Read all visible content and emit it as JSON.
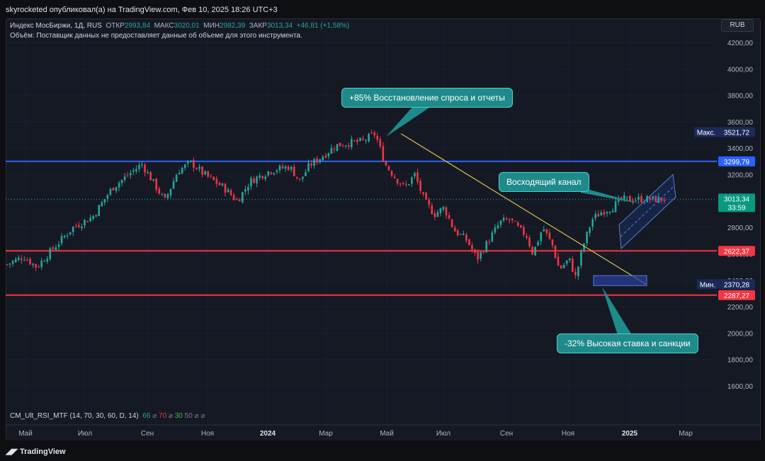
{
  "header": {
    "published": "skyrocketed опубликовал(а) на TradingView.com, Фев 10, 2025 18:26 UTC+3"
  },
  "legend": {
    "symbol": "Индекс МосБиржи, 1Д, RUS",
    "open_label": "ОТКР",
    "open": "2993,84",
    "high_label": "МАКС",
    "high": "3020,01",
    "low_label": "МИН",
    "low": "2982,39",
    "close_label": "ЗАКР",
    "close": "3013,34",
    "change": "+46,81 (+1,58%)",
    "volume_note": "Объём: Поставщик данных не предоставляет данные об объеме для этого инструмента."
  },
  "currency": "RUB",
  "indicator": {
    "name": "CM_Ult_RSI_MTF (14, 70, 30, 60, D, 14)",
    "v1": "66",
    "v2": "70",
    "v3": "30",
    "v4": "50",
    "c1": "#26a69a",
    "c2": "#f23645",
    "c3": "#4caf50",
    "c4": "#787b86"
  },
  "callouts": {
    "top": "+85% Восстановление спроса и отчеты",
    "channel": "Восходящий канал",
    "bottom": "-32% Высокая ставка и санкции"
  },
  "brand": "TradingView",
  "chart_data": {
    "type": "candlestick",
    "y_ticks": [
      "4200,00",
      "4000,00",
      "3800,00",
      "3600,00",
      "3400,00",
      "3200,00",
      "3000,00",
      "2800,00",
      "2600,00",
      "2400,00",
      "2200,00",
      "2000,00",
      "1800,00",
      "1600,00"
    ],
    "y_tick_values": [
      4200,
      4000,
      3800,
      3600,
      3400,
      3200,
      3000,
      2800,
      2600,
      2400,
      2200,
      2000,
      1800,
      1600
    ],
    "x_ticks": [
      "Май",
      "Июл",
      "Сен",
      "Ноя",
      "2024",
      "Мар",
      "Май",
      "Июл",
      "Сен",
      "Ноя",
      "2025",
      "Мар"
    ],
    "ylim": [
      1480,
      4260
    ],
    "price_labels": {
      "max_label": "Макс.",
      "max": "3521,72",
      "blue_level": "3299,79",
      "last": "3013,34",
      "timer": "33:59",
      "red_level_1": "2622,37",
      "min_label": "Мин.",
      "min": "2370,28",
      "red_level_2": "2287,27"
    },
    "levels": {
      "blue": {
        "value": 3299.79,
        "color": "#2962ff"
      },
      "red1": {
        "value": 2622.37,
        "color": "#f23645"
      },
      "red2": {
        "value": 2287.27,
        "color": "#f23645"
      },
      "last_dotted": {
        "value": 3013.34,
        "color": "#26a69a"
      }
    },
    "anchors": [
      {
        "t": 0,
        "v": 2520
      },
      {
        "t": 0.025,
        "v": 2580
      },
      {
        "t": 0.045,
        "v": 2500
      },
      {
        "t": 0.07,
        "v": 2640
      },
      {
        "t": 0.1,
        "v": 2800
      },
      {
        "t": 0.13,
        "v": 2880
      },
      {
        "t": 0.16,
        "v": 3100
      },
      {
        "t": 0.19,
        "v": 3220
      },
      {
        "t": 0.205,
        "v": 3280
      },
      {
        "t": 0.225,
        "v": 3120
      },
      {
        "t": 0.24,
        "v": 3000
      },
      {
        "t": 0.26,
        "v": 3230
      },
      {
        "t": 0.28,
        "v": 3290
      },
      {
        "t": 0.3,
        "v": 3200
      },
      {
        "t": 0.33,
        "v": 3100
      },
      {
        "t": 0.35,
        "v": 3000
      },
      {
        "t": 0.37,
        "v": 3150
      },
      {
        "t": 0.4,
        "v": 3230
      },
      {
        "t": 0.43,
        "v": 3260
      },
      {
        "t": 0.445,
        "v": 3150
      },
      {
        "t": 0.46,
        "v": 3270
      },
      {
        "t": 0.48,
        "v": 3340
      },
      {
        "t": 0.5,
        "v": 3420
      },
      {
        "t": 0.52,
        "v": 3440
      },
      {
        "t": 0.54,
        "v": 3450
      },
      {
        "t": 0.56,
        "v": 3510
      },
      {
        "t": 0.575,
        "v": 3280
      },
      {
        "t": 0.59,
        "v": 3180
      },
      {
        "t": 0.605,
        "v": 3100
      },
      {
        "t": 0.62,
        "v": 3200
      },
      {
        "t": 0.635,
        "v": 3000
      },
      {
        "t": 0.65,
        "v": 2900
      },
      {
        "t": 0.665,
        "v": 2950
      },
      {
        "t": 0.68,
        "v": 2780
      },
      {
        "t": 0.7,
        "v": 2700
      },
      {
        "t": 0.715,
        "v": 2560
      },
      {
        "t": 0.73,
        "v": 2680
      },
      {
        "t": 0.75,
        "v": 2840
      },
      {
        "t": 0.765,
        "v": 2860
      },
      {
        "t": 0.78,
        "v": 2780
      },
      {
        "t": 0.79,
        "v": 2740
      },
      {
        "t": 0.8,
        "v": 2600
      },
      {
        "t": 0.815,
        "v": 2800
      },
      {
        "t": 0.83,
        "v": 2660
      },
      {
        "t": 0.84,
        "v": 2480
      },
      {
        "t": 0.855,
        "v": 2560
      },
      {
        "t": 0.865,
        "v": 2420
      },
      {
        "t": 0.875,
        "v": 2640
      },
      {
        "t": 0.89,
        "v": 2860
      },
      {
        "t": 0.905,
        "v": 2920
      },
      {
        "t": 0.92,
        "v": 2950
      },
      {
        "t": 0.935,
        "v": 3013
      }
    ]
  }
}
